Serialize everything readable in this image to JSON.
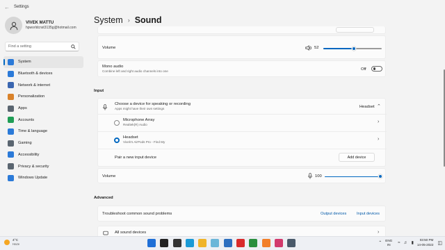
{
  "window": {
    "title": "Settings",
    "back_glyph": "←"
  },
  "user": {
    "name": "VIVEK MATTU",
    "email": "hpworldcnst3135g@hotmail.com"
  },
  "search": {
    "placeholder": "Find a setting",
    "icon": "search-icon"
  },
  "nav": [
    {
      "label": "System",
      "icon": "system-icon",
      "color": "#2b7ad8",
      "active": true
    },
    {
      "label": "Bluetooth & devices",
      "icon": "bluetooth-icon",
      "color": "#2b7ad8"
    },
    {
      "label": "Network & internet",
      "icon": "network-icon",
      "color": "#3a66b0"
    },
    {
      "label": "Personalization",
      "icon": "brush-icon",
      "color": "#d9822b"
    },
    {
      "label": "Apps",
      "icon": "apps-icon",
      "color": "#5a6570"
    },
    {
      "label": "Accounts",
      "icon": "account-icon",
      "color": "#1f9d55"
    },
    {
      "label": "Time & language",
      "icon": "globe-icon",
      "color": "#2b7ad8"
    },
    {
      "label": "Gaming",
      "icon": "gamepad-icon",
      "color": "#5a6570"
    },
    {
      "label": "Accessibility",
      "icon": "accessibility-icon",
      "color": "#2b7ad8"
    },
    {
      "label": "Privacy & security",
      "icon": "shield-icon",
      "color": "#5a6570"
    },
    {
      "label": "Windows Update",
      "icon": "update-icon",
      "color": "#2b7ad8"
    }
  ],
  "breadcrumb": {
    "parent": "System",
    "separator": "›",
    "current": "Sound"
  },
  "output": {
    "volume_label": "Volume",
    "volume_value": "52",
    "volume_level": 0.52,
    "mono_title": "Mono audio",
    "mono_sub": "Combine left and right audio channels into one",
    "mono_state": "Off"
  },
  "input": {
    "section": "Input",
    "choose_title": "Choose a device for speaking or recording",
    "choose_sub": "Apps might have their own settings",
    "selected": "Headset",
    "devices": [
      {
        "name": "Microphone Array",
        "sub": "Realtek(R) Audio",
        "selected": false
      },
      {
        "name": "Headset",
        "sub": "Vivek's AirPods Pro - Find My",
        "selected": true
      }
    ],
    "pair_label": "Pair a new input device",
    "add_button": "Add device",
    "volume_label": "Volume",
    "volume_value": "100",
    "volume_level": 1.0
  },
  "advanced": {
    "section": "Advanced",
    "troubleshoot": "Troubleshoot common sound problems",
    "output_link": "Output devices",
    "input_link": "Input devices",
    "all_devices": "All sound devices"
  },
  "taskbar": {
    "temp": "4°C",
    "condition": "Haze",
    "apps": [
      {
        "icon": "windows-start-icon",
        "color": "#1f6fd6"
      },
      {
        "icon": "taskbar-search-icon",
        "color": "#222"
      },
      {
        "icon": "task-view-icon",
        "color": "#333"
      },
      {
        "icon": "edge-browser-icon",
        "color": "#1a9ad6"
      },
      {
        "icon": "file-explorer-icon",
        "color": "#f0b429"
      },
      {
        "icon": "media-app-icon",
        "color": "#6bb6d8"
      },
      {
        "icon": "store-icon",
        "color": "#2d6fbf"
      },
      {
        "icon": "red-app-icon",
        "color": "#d92b2b"
      },
      {
        "icon": "chrome-icon",
        "color": "#2a8f3e"
      },
      {
        "icon": "orange-app-icon",
        "color": "#f27f29"
      },
      {
        "icon": "music-app-icon",
        "color": "#d23a6c"
      },
      {
        "icon": "settings-gear-icon",
        "color": "#4a5a6a"
      }
    ],
    "lang_top": "ENG",
    "lang_bottom": "IN",
    "time": "03:50 PM",
    "date": "14-05-2022"
  }
}
